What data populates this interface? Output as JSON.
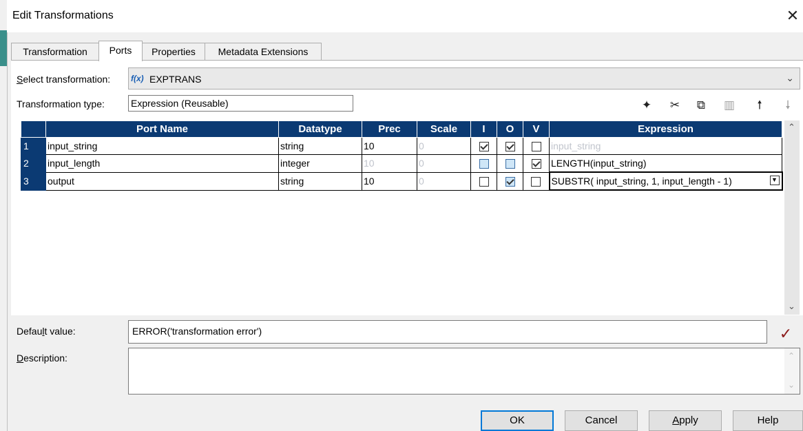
{
  "window": {
    "title": "Edit Transformations",
    "close_glyph": "✕"
  },
  "tabs": [
    {
      "label": "Transformation",
      "active": false
    },
    {
      "label": "Ports",
      "active": true
    },
    {
      "label": "Properties",
      "active": false
    },
    {
      "label": "Metadata Extensions",
      "active": false
    }
  ],
  "select_transformation": {
    "label_pre": "S",
    "label_post": "elect transformation:",
    "icon": "f(x)",
    "value": "EXPTRANS"
  },
  "transformation_type": {
    "label": "Transformation type:",
    "value": "Expression (Reusable)"
  },
  "toolbar": {
    "icons": [
      "new-port-icon",
      "cut-icon",
      "copy-icon",
      "paste-icon",
      "move-up-icon",
      "move-down-icon"
    ]
  },
  "grid": {
    "headers": [
      "Port Name",
      "Datatype",
      "Prec",
      "Scale",
      "I",
      "O",
      "V",
      "Expression"
    ],
    "rows": [
      {
        "num": "1",
        "name": "input_string",
        "datatype": "string",
        "prec": "10",
        "scale": "0",
        "i": "checked",
        "o": "checked",
        "v": "empty",
        "expression": "input_string"
      },
      {
        "num": "2",
        "name": "input_length",
        "datatype": "integer",
        "prec": "10",
        "scale": "0",
        "i": "blue",
        "o": "blue",
        "v": "checked",
        "expression": "LENGTH(input_string)"
      },
      {
        "num": "3",
        "name": "output",
        "datatype": "string",
        "prec": "10",
        "scale": "0",
        "i": "empty",
        "o": "blue-checked",
        "v": "empty",
        "expression": "SUBSTR( input_string, 1, input_length - 1)"
      }
    ]
  },
  "default_value": {
    "label_pre": "Defau",
    "label_u": "l",
    "label_post": "t value:",
    "value": "ERROR('transformation error')"
  },
  "description": {
    "label_pre": "D",
    "label_post": "escription:",
    "value": ""
  },
  "buttons": {
    "ok": "OK",
    "cancel": "Cancel",
    "apply_u": "A",
    "apply_rest": "pply",
    "help": "Help"
  },
  "colors": {
    "grid_header": "#0b3a73",
    "validate_check": "#8b1a1a",
    "default_button_border": "#0078d7"
  }
}
